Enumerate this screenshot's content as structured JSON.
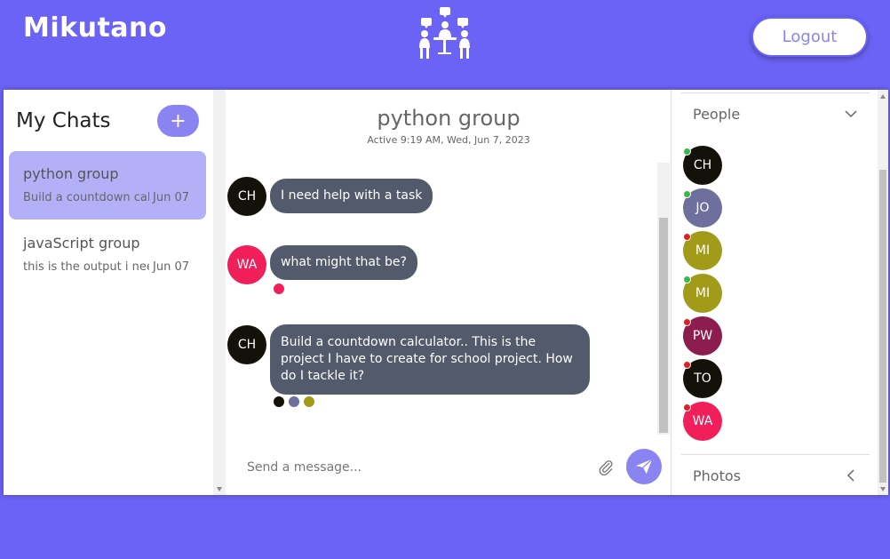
{
  "header": {
    "brand": "Mikutano",
    "logo_icon": "meeting-icon",
    "logout_label": "Logout"
  },
  "sidebar": {
    "title": "My Chats",
    "add_label": "+",
    "chats": [
      {
        "name": "python group",
        "preview": "Build a countdown calculator.. This is the project I have to create for school project.",
        "date": "Jun 07",
        "active": true
      },
      {
        "name": "javaScript group",
        "preview": "this is the output i need",
        "date": "Jun 07",
        "active": false
      }
    ]
  },
  "conversation": {
    "title": "python group",
    "subtitle": "Active 9:19 AM, Wed, Jun 7, 2023",
    "messages": [
      {
        "initials": "CH",
        "avatar_color": "#14110a",
        "text": "I need help with a task"
      },
      {
        "initials": "WA",
        "avatar_color": "#f01f59",
        "text": "what might that be?"
      },
      {
        "initials": "CH",
        "avatar_color": "#14110a",
        "text": "Build a countdown calculator.. This is the project I have to create for school project. How do I tackle it?"
      }
    ],
    "input_placeholder": "Send a message...",
    "attach_icon": "paperclip-icon",
    "send_icon": "send-icon"
  },
  "people": {
    "section_label": "People",
    "members": [
      {
        "initials": "CH",
        "color": "#14110a",
        "status": "#3cb64a"
      },
      {
        "initials": "JO",
        "color": "#6f6f9e",
        "status": "#3cb64a"
      },
      {
        "initials": "MI",
        "color": "#a29a19",
        "status": "#e02020"
      },
      {
        "initials": "MI",
        "color": "#a29a19",
        "status": "#3cb64a"
      },
      {
        "initials": "PW",
        "color": "#8c1d4e",
        "status": "#e02020"
      },
      {
        "initials": "TO",
        "color": "#14110a",
        "status": "#e02020"
      },
      {
        "initials": "WA",
        "color": "#f01f59",
        "status": "#e02020"
      }
    ],
    "photos_label": "Photos"
  },
  "colors": {
    "brand": "#6b63f5",
    "accent": "#8a84f3",
    "active_chat": "#b3b0f7",
    "bubble": "#535a6b"
  }
}
